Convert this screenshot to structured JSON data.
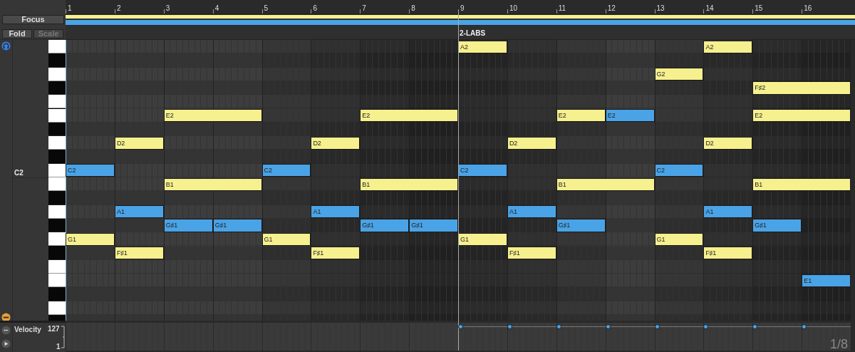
{
  "left_panel": {
    "focus_button": "Focus",
    "fold_button": {
      "label": "Fold",
      "on": true
    },
    "scale_button": {
      "label": "Scale",
      "on": false
    }
  },
  "ruler": [
    "1",
    "2",
    "3",
    "4",
    "5",
    "6",
    "7",
    "8",
    "9",
    "10",
    "11",
    "12",
    "13",
    "14",
    "15",
    "16"
  ],
  "clip_label": "2-LABS",
  "lanes": [
    {
      "kind": "natural",
      "notes": [
        {
          "label": "A2",
          "color": "#f6f08e"
        },
        {
          "label": "A2",
          "color": "#f6f08e"
        }
      ]
    },
    {
      "kind": "sharp"
    },
    {
      "kind": "natural",
      "notes": [
        {
          "label": "G2",
          "color": "#f6f08e"
        }
      ]
    },
    {
      "kind": "sharp",
      "notes": [
        {
          "label": "F♯2",
          "color": "#f6f08e"
        }
      ]
    },
    {
      "kind": "natural"
    },
    {
      "kind": "natural",
      "notes": [
        {
          "label": "E2",
          "color": "#f6f08e"
        },
        {
          "label": "E2",
          "color": "#f6f08e"
        },
        {
          "label": "E2",
          "color": "#f6f08e"
        },
        {
          "label": "E2",
          "color": "#4aa3e6"
        },
        {
          "label": "E2",
          "color": "#f6f08e"
        }
      ]
    },
    {
      "kind": "sharp"
    },
    {
      "kind": "natural",
      "notes": [
        {
          "label": "D2",
          "color": "#f6f08e"
        },
        {
          "label": "D2",
          "color": "#f6f08e"
        },
        {
          "label": "D2",
          "color": "#f6f08e"
        },
        {
          "label": "D2",
          "color": "#f6f08e"
        }
      ]
    },
    {
      "kind": "sharp"
    },
    {
      "kind": "natural",
      "key_label": "C2",
      "notes": [
        {
          "label": "C2",
          "color": "#4aa3e6"
        },
        {
          "label": "C2",
          "color": "#4aa3e6"
        },
        {
          "label": "C2",
          "color": "#4aa3e6"
        },
        {
          "label": "C2",
          "color": "#4aa3e6"
        }
      ]
    },
    {
      "kind": "natural",
      "notes": [
        {
          "label": "B1",
          "color": "#f6f08e"
        },
        {
          "label": "B1",
          "color": "#f6f08e"
        },
        {
          "label": "B1",
          "color": "#f6f08e"
        },
        {
          "label": "B1",
          "color": "#f6f08e"
        }
      ]
    },
    {
      "kind": "sharp"
    },
    {
      "kind": "natural",
      "notes": [
        {
          "label": "A1",
          "color": "#4aa3e6"
        },
        {
          "label": "A1",
          "color": "#4aa3e6"
        },
        {
          "label": "A1",
          "color": "#4aa3e6"
        },
        {
          "label": "A1",
          "color": "#4aa3e6"
        }
      ]
    },
    {
      "kind": "sharp",
      "notes": [
        {
          "label": "G♯1",
          "color": "#4aa3e6"
        },
        {
          "label": "G♯1",
          "color": "#4aa3e6"
        },
        {
          "label": "G♯1",
          "color": "#4aa3e6"
        },
        {
          "label": "G♯1",
          "color": "#4aa3e6"
        },
        {
          "label": "G♯1",
          "color": "#4aa3e6"
        },
        {
          "label": "G♯1",
          "color": "#4aa3e6"
        }
      ]
    },
    {
      "kind": "natural",
      "notes": [
        {
          "label": "G1",
          "color": "#f6f08e"
        },
        {
          "label": "G1",
          "color": "#f6f08e"
        },
        {
          "label": "G1",
          "color": "#f6f08e"
        },
        {
          "label": "G1",
          "color": "#f6f08e"
        }
      ]
    },
    {
      "kind": "sharp",
      "notes": [
        {
          "label": "F♯1",
          "color": "#f6f08e"
        },
        {
          "label": "F♯1",
          "color": "#f6f08e"
        },
        {
          "label": "F♯1",
          "color": "#f6f08e"
        },
        {
          "label": "F♯1",
          "color": "#f6f08e"
        }
      ]
    },
    {
      "kind": "natural"
    },
    {
      "kind": "natural",
      "notes": [
        {
          "label": "E1",
          "color": "#4aa3e6"
        }
      ]
    },
    {
      "kind": "sharp"
    },
    {
      "kind": "natural"
    },
    {
      "kind": "sharp"
    }
  ],
  "velocity": {
    "label": "Velocity",
    "max": "127",
    "min": "1"
  },
  "grid_setting": "1/8"
}
